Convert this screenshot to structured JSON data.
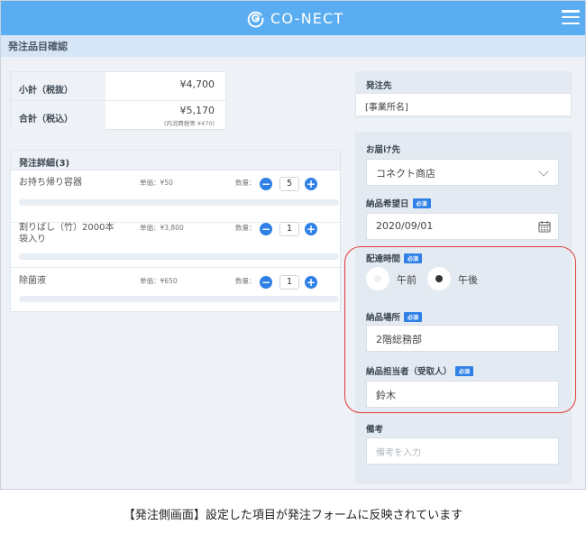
{
  "header": {
    "logo_text": "CO-NECT",
    "brand_color": "#5aadf0"
  },
  "page": {
    "title": "発注品目確認"
  },
  "summary": {
    "subtotal_label": "小計（税抜）",
    "subtotal_value": "¥4,700",
    "total_label": "合計（税込）",
    "total_value": "¥5,170",
    "tax_note": "(内消費税等 ¥470)"
  },
  "details": {
    "header": "発注詳細(3)",
    "items": [
      {
        "name": "お持ち帰り容器",
        "price": "単価：¥50",
        "qty_label": "数量：",
        "qty": "5"
      },
      {
        "name": "割りばし（竹）2000本　袋入り",
        "price": "単価：¥3,800",
        "qty_label": "数量：",
        "qty": "1"
      },
      {
        "name": "除菌液",
        "price": "単価：¥650",
        "qty_label": "数量：",
        "qty": "1"
      }
    ]
  },
  "destination": {
    "label": "発注先",
    "value": "[事業所名]"
  },
  "delivery": {
    "dest_label": "お届け先",
    "dest_value": "コネクト商店",
    "date_label": "納品希望日",
    "date_value": "2020/09/01",
    "time_label": "配達時間",
    "time_options": [
      {
        "label": "午前",
        "selected": false
      },
      {
        "label": "午後",
        "selected": true
      }
    ],
    "place_label": "納品場所",
    "place_value": "2階総務部",
    "person_label": "納品担当者（受取人）",
    "person_value": "鈴木",
    "note_label": "備考",
    "note_placeholder": "備考を入力",
    "required_badge": "必須"
  },
  "caption": "【発注側画面】設定した項目が発注フォームに反映されています"
}
